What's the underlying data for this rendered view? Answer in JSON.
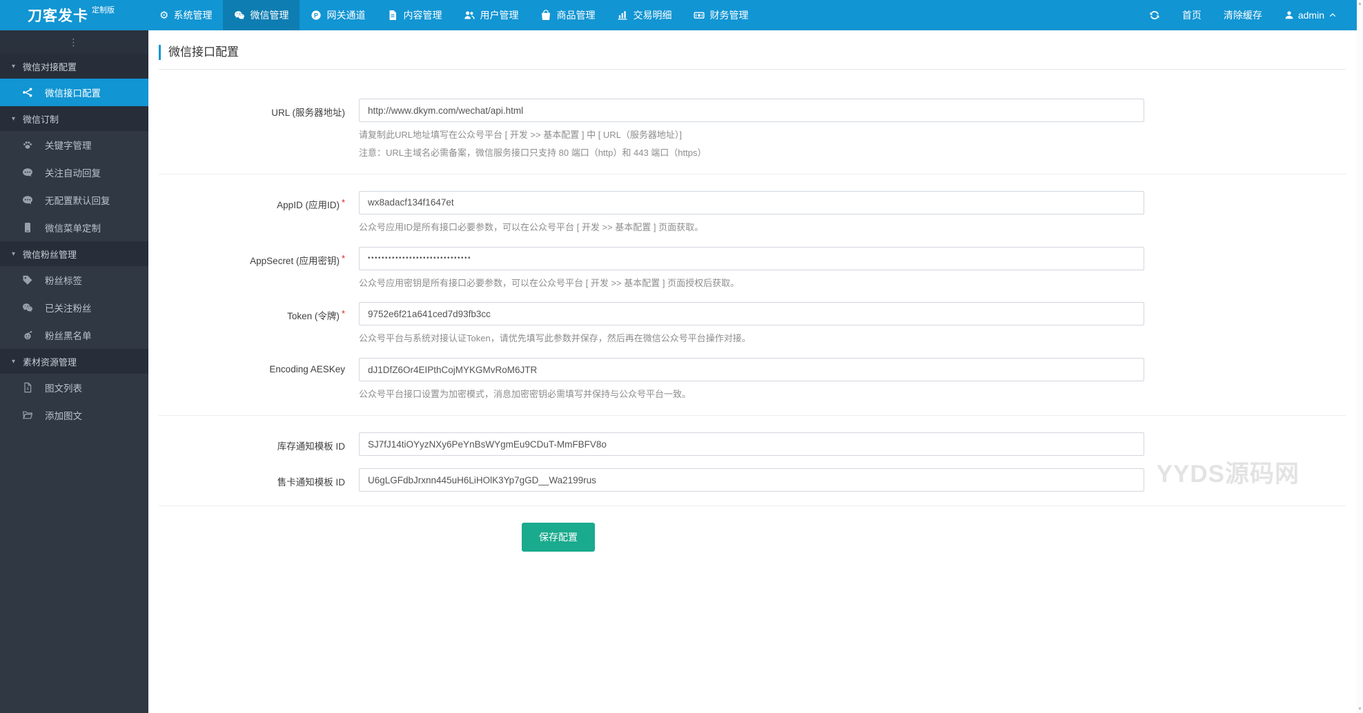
{
  "topbar": {
    "logo": "刀客发卡",
    "logo_badge": "定制版",
    "nav": [
      {
        "key": "system",
        "label": "系统管理",
        "icon": "gear-icon",
        "active": false
      },
      {
        "key": "wechat",
        "label": "微信管理",
        "icon": "wechat-icon",
        "active": true
      },
      {
        "key": "gateway",
        "label": "网关通道",
        "icon": "gateway-icon",
        "active": false
      },
      {
        "key": "content",
        "label": "内容管理",
        "icon": "document-icon",
        "active": false
      },
      {
        "key": "users",
        "label": "用户管理",
        "icon": "users-icon",
        "active": false
      },
      {
        "key": "products",
        "label": "商品管理",
        "icon": "shopping-bag-icon",
        "active": false
      },
      {
        "key": "transactions",
        "label": "交易明细",
        "icon": "bar-chart-icon",
        "active": false
      },
      {
        "key": "finance",
        "label": "财务管理",
        "icon": "finance-icon",
        "active": false
      }
    ],
    "right": {
      "home": "首页",
      "clear_cache": "清除缓存",
      "username": "admin"
    }
  },
  "sidebar": {
    "toggle_glyph": "⋮",
    "groups": [
      {
        "key": "wechat-connect-config",
        "label": "微信对接配置",
        "items": [
          {
            "key": "wechat-api-config",
            "label": "微信接口配置",
            "icon": "share-icon",
            "active": true
          }
        ]
      },
      {
        "key": "wechat-custom",
        "label": "微信订制",
        "items": [
          {
            "key": "keyword-manage",
            "label": "关键字管理",
            "icon": "paw-icon",
            "active": false
          },
          {
            "key": "follow-auto-reply",
            "label": "关注自动回复",
            "icon": "comment-icon",
            "active": false
          },
          {
            "key": "default-reply",
            "label": "无配置默认回复",
            "icon": "comment-icon",
            "active": false
          },
          {
            "key": "wechat-menu",
            "label": "微信菜单定制",
            "icon": "mobile-icon",
            "active": false
          }
        ]
      },
      {
        "key": "wechat-fans",
        "label": "微信粉丝管理",
        "items": [
          {
            "key": "fan-tags",
            "label": "粉丝标签",
            "icon": "tag-icon",
            "active": false
          },
          {
            "key": "followed-fans",
            "label": "已关注粉丝",
            "icon": "wechat-icon",
            "active": false
          },
          {
            "key": "fan-blacklist",
            "label": "粉丝黑名单",
            "icon": "blacklist-icon",
            "active": false
          }
        ]
      },
      {
        "key": "material-resource",
        "label": "素材资源管理",
        "items": [
          {
            "key": "article-list",
            "label": "图文列表",
            "icon": "file-icon",
            "active": false
          },
          {
            "key": "add-article",
            "label": "添加图文",
            "icon": "folder-icon",
            "active": false
          }
        ]
      }
    ]
  },
  "main": {
    "page_title": "微信接口配置",
    "fields": [
      {
        "key": "url",
        "label": "URL (服务器地址)",
        "required": false,
        "type": "text",
        "value": "http://www.dkym.com/wechat/api.html",
        "help": [
          "请复制此URL地址填写在公众号平台 [ 开发 >> 基本配置 ] 中 [ URL（服务器地址）]",
          "注意：URL主域名必需备案，微信服务接口只支持 80 端口（http）和 443 端口（https）"
        ],
        "divider_after": true
      },
      {
        "key": "appid",
        "label": "AppID (应用ID)",
        "required": true,
        "type": "text",
        "value": "wx8adacf134f1647et",
        "help": [
          "公众号应用ID是所有接口必要参数，可以在公众号平台 [ 开发 >> 基本配置 ] 页面获取。"
        ],
        "divider_after": false
      },
      {
        "key": "appsecret",
        "label": "AppSecret (应用密钥)",
        "required": true,
        "type": "password",
        "value": "••••••••••••••••••••••••••••••",
        "help": [
          "公众号应用密钥是所有接口必要参数，可以在公众号平台 [ 开发 >> 基本配置 ] 页面授权后获取。"
        ],
        "divider_after": false
      },
      {
        "key": "token",
        "label": "Token (令牌)",
        "required": true,
        "type": "text",
        "value": "9752e6f21a641ced7d93fb3cc",
        "help": [
          "公众号平台与系统对接认证Token，请优先填写此参数并保存，然后再在微信公众号平台操作对接。"
        ],
        "divider_after": false
      },
      {
        "key": "aeskey",
        "label": "Encoding AESKey",
        "required": false,
        "type": "text",
        "value": "dJ1DfZ6Or4EIPthCojMYKGMvRoM6JTR",
        "help": [
          "公众号平台接口设置为加密模式，消息加密密钥必需填写并保持与公众号平台一致。"
        ],
        "divider_after": true
      },
      {
        "key": "stock-template-id",
        "label": "库存通知模板 ID",
        "required": false,
        "type": "text",
        "value": "SJ7fJ14tiOYyzNXy6PeYnBsWYgmEu9CDuT-MmFBFV8o",
        "help": [],
        "divider_after": false
      },
      {
        "key": "sale-template-id",
        "label": "售卡通知模板 ID",
        "required": false,
        "type": "text",
        "value": "U6gLGFdbJrxnn445uH6LiHOlK3Yp7gGD__Wa2199rus",
        "help": [],
        "divider_after": true
      }
    ],
    "save_button": "保存配置",
    "watermark": "YYDS源码网"
  },
  "colors": {
    "accent": "#1195d3",
    "topbar_active": "#0f84bb",
    "sidebar_bg": "#303844",
    "sidebar_group_bg": "#272e39",
    "save_button": "#1aaa8d",
    "required": "#e02222",
    "watermark": "#e3e3e3"
  }
}
